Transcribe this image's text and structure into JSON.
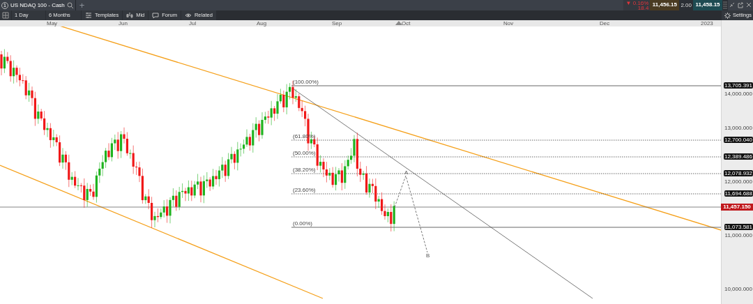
{
  "tabs": [
    {
      "number": "1",
      "title": "US NDAQ 100 - Cash",
      "selected": true
    }
  ],
  "add_tab": "+",
  "toolbar": {
    "interval": "1 Day",
    "range": "6 Months",
    "buttons": [
      {
        "label": "Templates",
        "kind": "templates"
      },
      {
        "label": "Mid",
        "kind": "mid"
      },
      {
        "label": "Forum",
        "kind": "forum"
      },
      {
        "label": "Related",
        "kind": "related"
      }
    ],
    "settings": "Settings"
  },
  "quote": {
    "change_pct": "▼ 0.16%",
    "change": "18.4",
    "bid": "11,456.15",
    "ask": "11,458.15",
    "spread": "2.00"
  },
  "time_axis": [
    "May",
    "Jun",
    "Jul",
    "Aug",
    "Sep",
    "Oct",
    "Nov",
    "Dec",
    "2023"
  ],
  "price_ticks": [
    "14,000.000",
    "13,000.000",
    "12,000.000",
    "11,000.000",
    "10,000.000"
  ],
  "price_labels": [
    {
      "text": "13,705.391",
      "kind": "level"
    },
    {
      "text": "12,700.040",
      "kind": "level"
    },
    {
      "text": "12,389.486",
      "kind": "level"
    },
    {
      "text": "12,078.932",
      "kind": "level"
    },
    {
      "text": "11,694.688",
      "kind": "level"
    },
    {
      "text": "11,457.150",
      "kind": "current"
    },
    {
      "text": "11,073.581",
      "kind": "level"
    }
  ],
  "fib_levels": [
    "(100.00%)",
    "(61.80%)",
    "(50.00%)",
    "(38.20%)",
    "(23.60%)",
    "(0.00%)"
  ],
  "pattern_points": [
    "A",
    "B"
  ]
}
